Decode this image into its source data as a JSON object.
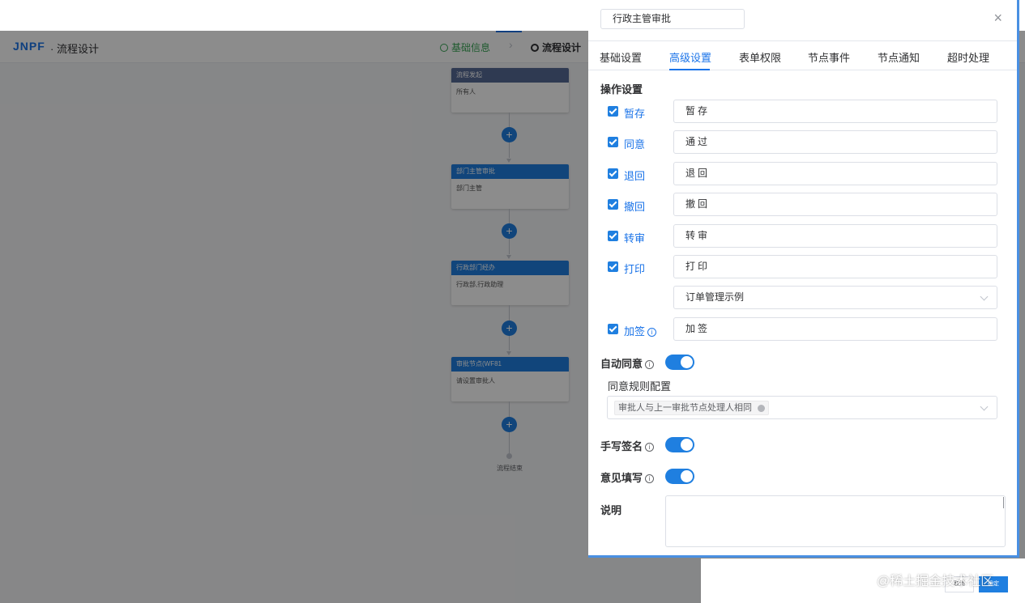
{
  "header": {
    "logo": "JNPF",
    "title": "· 流程设计",
    "steps": [
      {
        "label": "基础信息",
        "state": "done"
      },
      {
        "label": "流程设计",
        "state": "current"
      }
    ]
  },
  "flow": {
    "nodes": [
      {
        "title": "流程发起",
        "body": "所有人",
        "kind": "start"
      },
      {
        "title": "部门主管审批",
        "body": "部门主管",
        "kind": "approver"
      },
      {
        "title": "行政部门经办",
        "body": "行政部,行政助理",
        "kind": "approver"
      },
      {
        "title": "审批节点(WF81",
        "body": "请设置审批人",
        "kind": "approver"
      }
    ],
    "add_symbol": "+",
    "end_label": "流程结束"
  },
  "drawer": {
    "title_value": "行政主管审批",
    "close_symbol": "×",
    "tabs": [
      "基础设置",
      "高级设置",
      "表单权限",
      "节点事件",
      "节点通知",
      "超时处理"
    ],
    "active_tab": "高级设置",
    "operation_section": "操作设置",
    "operations": [
      {
        "label": "暂存",
        "checked": true,
        "value": "暂存"
      },
      {
        "label": "同意",
        "checked": true,
        "value": "通过"
      },
      {
        "label": "退回",
        "checked": true,
        "value": "退回"
      },
      {
        "label": "撤回",
        "checked": true,
        "value": "撤回"
      },
      {
        "label": "转审",
        "checked": true,
        "value": "转审"
      },
      {
        "label": "打印",
        "checked": true,
        "value": "打印"
      }
    ],
    "print_template": "订单管理示例",
    "countersign": {
      "label": "加签",
      "checked": true,
      "value": "加签"
    },
    "auto_approve": {
      "label": "自动同意",
      "on": true
    },
    "approve_rule_label": "同意规则配置",
    "approve_rule_tag": "审批人与上一审批节点处理人相同",
    "handwritten_signature": {
      "label": "手写签名",
      "on": true
    },
    "opinion_fill": {
      "label": "意见填写",
      "on": true
    },
    "description_label": "说明",
    "info_symbol": "i"
  },
  "footer": {
    "cancel_label": "取消",
    "ok_label": "确定",
    "watermark": "@稀土掘金技术社区"
  },
  "colors": {
    "accent": "#1f7fe0",
    "start_node": "#576a95",
    "step_done": "#3aa657"
  }
}
